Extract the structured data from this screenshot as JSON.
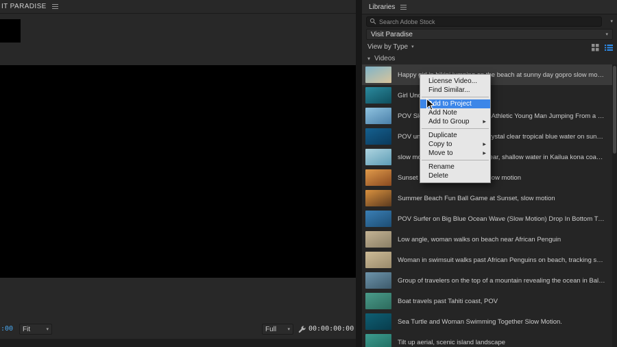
{
  "accent": {
    "blue": "#2d8ceb",
    "menu_highlight": "#3c86e8",
    "timecode_blue": "#49a8f0"
  },
  "left_panel": {
    "tab_label": "IT PARADISE",
    "timecode_current": ":00",
    "zoom_level": "Fit",
    "playback_resolution": "Full",
    "timecode_total": "00:00:00:00"
  },
  "libraries": {
    "panel_title": "Libraries",
    "search_placeholder": "Search Adobe Stock",
    "library_name": "Visit Paradise",
    "view_by_label": "View by Type",
    "section_label": "Videos",
    "items": [
      {
        "title": "Happy girl in bikini jumping on the beach at sunny day gopro slow motion",
        "selected": true,
        "thumb": [
          "#7fb4c9",
          "#d9c49b"
        ]
      },
      {
        "title": "Girl Underwater Swim",
        "selected": false,
        "thumb": [
          "#2b8a9e",
          "#0f4f5e"
        ]
      },
      {
        "title": "POV Slow Motion Cliff Jumping. Athletic Young Man Jumping From a Cliff Into Blue Sea Water",
        "selected": false,
        "thumb": [
          "#8fc3e0",
          "#4a7fa8"
        ]
      },
      {
        "title": "POV underwater snorkeling in crystal clear tropical blue water on sunny summer day",
        "selected": false,
        "thumb": [
          "#15608f",
          "#0a3a5c"
        ]
      },
      {
        "title": "slow motion wave breaking in clear, shallow water in Kailua kona coast, Big Island Hawaii",
        "selected": false,
        "thumb": [
          "#aed4e0",
          "#5d9cb5"
        ]
      },
      {
        "title": "Sunset over the ocean waves, slow motion",
        "selected": false,
        "thumb": [
          "#e09a4a",
          "#8a4a20"
        ]
      },
      {
        "title": "Summer Beach Fun Ball Game at Sunset, slow motion",
        "selected": false,
        "thumb": [
          "#d9913f",
          "#5c3a1e"
        ]
      },
      {
        "title": "POV Surfer on Big Blue Ocean Wave (Slow Motion) Drop In Bottom Turn Frontside",
        "selected": false,
        "thumb": [
          "#3a7fb5",
          "#1d4d73"
        ]
      },
      {
        "title": "Low angle, woman walks on beach near African Penguin",
        "selected": false,
        "thumb": [
          "#c4b394",
          "#8a7f66"
        ]
      },
      {
        "title": "Woman in swimsuit walks past African Penguins on beach, tracking shot",
        "selected": false,
        "thumb": [
          "#cdbb97",
          "#9a8b6c"
        ]
      },
      {
        "title": "Group of travelers on the top of a mountain revealing the ocean in Balos, Crete – Drone footage",
        "selected": false,
        "thumb": [
          "#6d94ab",
          "#3d5a6b"
        ]
      },
      {
        "title": "Boat travels past Tahiti coast, POV",
        "selected": false,
        "thumb": [
          "#4a9b8a",
          "#2d6b5d"
        ]
      },
      {
        "title": "Sea Turtle and Woman Swimming Together Slow Motion.",
        "selected": false,
        "thumb": [
          "#0f5f73",
          "#083d4d"
        ]
      },
      {
        "title": "Tilt up aerial, scenic island landscape",
        "selected": false,
        "thumb": [
          "#3d9b8f",
          "#1f6b5f"
        ]
      }
    ]
  },
  "context_menu": {
    "items": [
      {
        "type": "item",
        "label": "License Video..."
      },
      {
        "type": "item",
        "label": "Find Similar..."
      },
      {
        "type": "separator"
      },
      {
        "type": "item",
        "label": "Add to Project",
        "highlighted": true
      },
      {
        "type": "item",
        "label": "Add Note"
      },
      {
        "type": "item",
        "label": "Add to Group",
        "submenu": true
      },
      {
        "type": "separator"
      },
      {
        "type": "item",
        "label": "Duplicate"
      },
      {
        "type": "item",
        "label": "Copy to",
        "submenu": true
      },
      {
        "type": "item",
        "label": "Move to",
        "submenu": true
      },
      {
        "type": "separator"
      },
      {
        "type": "item",
        "label": "Rename"
      },
      {
        "type": "item",
        "label": "Delete"
      }
    ]
  }
}
